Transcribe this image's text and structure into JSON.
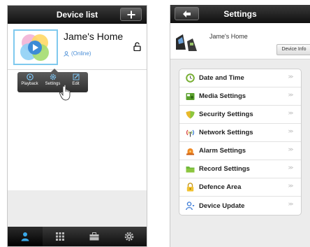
{
  "device_list": {
    "title": "Device list",
    "device": {
      "name": "Jame's Home",
      "status": "(Online)"
    },
    "popup": {
      "playback": "Playback",
      "settings": "Settings",
      "edit": "Edit"
    },
    "tabs": [
      "device-tab",
      "apps-tab",
      "gallery-tab",
      "settings-tab"
    ]
  },
  "settings": {
    "title": "Settings",
    "device_name": "Jame's Home",
    "device_info_button": "Device Info",
    "arrow": ">>",
    "items": [
      {
        "label": "Date and Time",
        "icon": "clock-icon"
      },
      {
        "label": "Media Settings",
        "icon": "media-icon"
      },
      {
        "label": "Security Settings",
        "icon": "shield-icon"
      },
      {
        "label": "Network Settings",
        "icon": "wifi-icon"
      },
      {
        "label": "Alarm Settings",
        "icon": "alarm-icon"
      },
      {
        "label": "Record Settings",
        "icon": "record-icon"
      },
      {
        "label": "Defence Area",
        "icon": "lock-icon"
      },
      {
        "label": "Device Update",
        "icon": "update-icon"
      }
    ]
  },
  "colors": {
    "accent_blue": "#4a8ed6",
    "bar_dark": "#101010",
    "active_tab_icon": "#3aa8e8"
  }
}
